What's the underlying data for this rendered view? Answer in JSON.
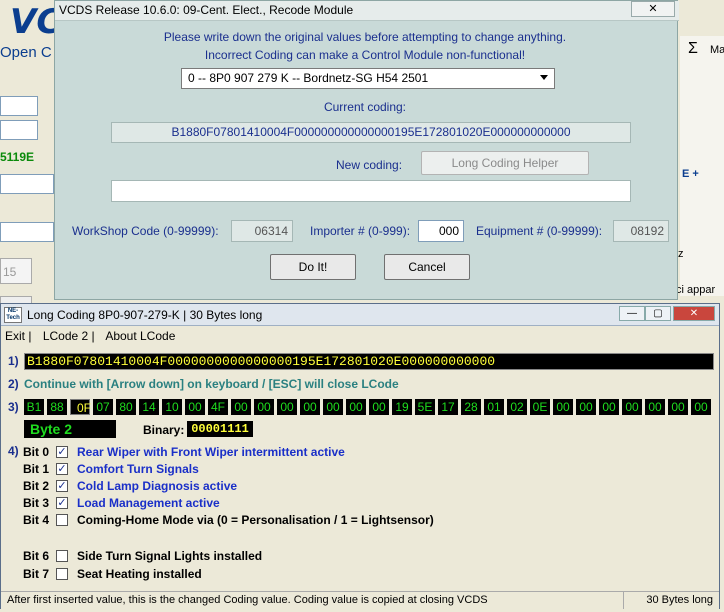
{
  "background": {
    "logo": "VC",
    "open_label": "Open C",
    "green_text": "5119E",
    "right_sigma": "Σ",
    "right_ma": "Ma",
    "right_e": "E +",
    "right_z": "z",
    "right_ci": "ci appar",
    "field_15": "15"
  },
  "recode": {
    "title": "VCDS Release 10.6.0: 09-Cent. Elect.,  Recode Module",
    "close": "✕",
    "warning_line1": "Please write down the original values before attempting to change anything.",
    "warning_line2": "Incorrect Coding can make a Control Module non-functional!",
    "module_select": "0 -- 8P0 907 279 K -- Bordnetz-SG      H54 2501",
    "current_coding_label": "Current coding:",
    "current_coding_value": "B1880F0780141000​4F000000000000000195E172801020E000000000000",
    "new_coding_label": "New coding:",
    "long_coding_helper": "Long Coding Helper",
    "workshop_label": "WorkShop Code (0-99999):",
    "workshop_value": "06314",
    "importer_label": "Importer # (0-999):",
    "importer_value": "000",
    "equipment_label": "Equipment # (0-99999):",
    "equipment_value": "08192",
    "do_it": "Do It!",
    "cancel": "Cancel"
  },
  "lcode": {
    "title": "Long Coding  8P0-907-279-K | 30 Bytes long",
    "logo": "NE-Tech",
    "menu": [
      "Exit |",
      "LCode 2 |",
      "About LCode"
    ],
    "row1_label": "1)",
    "coding_string": "B1880F07801410004F0000000000000000195E172801020E000000000000",
    "row2_label": "2)",
    "instruction": "Continue with [Arrow down] on keyboard / [ESC] will close LCode",
    "row3_label": "3)",
    "bytes": [
      "B1",
      "88",
      "0F",
      "07",
      "80",
      "14",
      "10",
      "00",
      "4F",
      "00",
      "00",
      "00",
      "00",
      "00",
      "00",
      "00",
      "19",
      "5E",
      "17",
      "28",
      "01",
      "02",
      "0E",
      "00",
      "00",
      "00",
      "00",
      "00",
      "00",
      "00"
    ],
    "selected_byte_index": 2,
    "byte_tag": "Byte 2",
    "binary_label": "Binary:",
    "binary_value": "00001111",
    "row4_label": "4)",
    "bits": [
      {
        "name": "Bit 0",
        "checked": true,
        "desc": "Rear Wiper with Front Wiper intermittent active"
      },
      {
        "name": "Bit 1",
        "checked": true,
        "desc": "Comfort Turn Signals"
      },
      {
        "name": "Bit 2",
        "checked": true,
        "desc": "Cold Lamp Diagnosis active"
      },
      {
        "name": "Bit 3",
        "checked": true,
        "desc": "Load Management active"
      },
      {
        "name": "Bit 4",
        "checked": false,
        "desc": "Coming-Home Mode via (0 = Personalisation / 1 = Lightsensor)"
      },
      {
        "name": "Bit 6",
        "checked": false,
        "desc": "Side Turn Signal Lights installed"
      },
      {
        "name": "Bit 7",
        "checked": false,
        "desc": "Seat Heating installed"
      }
    ],
    "status_left": "After first inserted value, this is the changed Coding value.  Coding value is copied at closing VCDS",
    "status_right": "30 Bytes long"
  },
  "colors": {
    "accent_blue": "#1a2f8e",
    "byte_green": "#1fdc1f",
    "highlight_yellow": "#ffff3a",
    "dialog_bg": "#c9dad8"
  }
}
